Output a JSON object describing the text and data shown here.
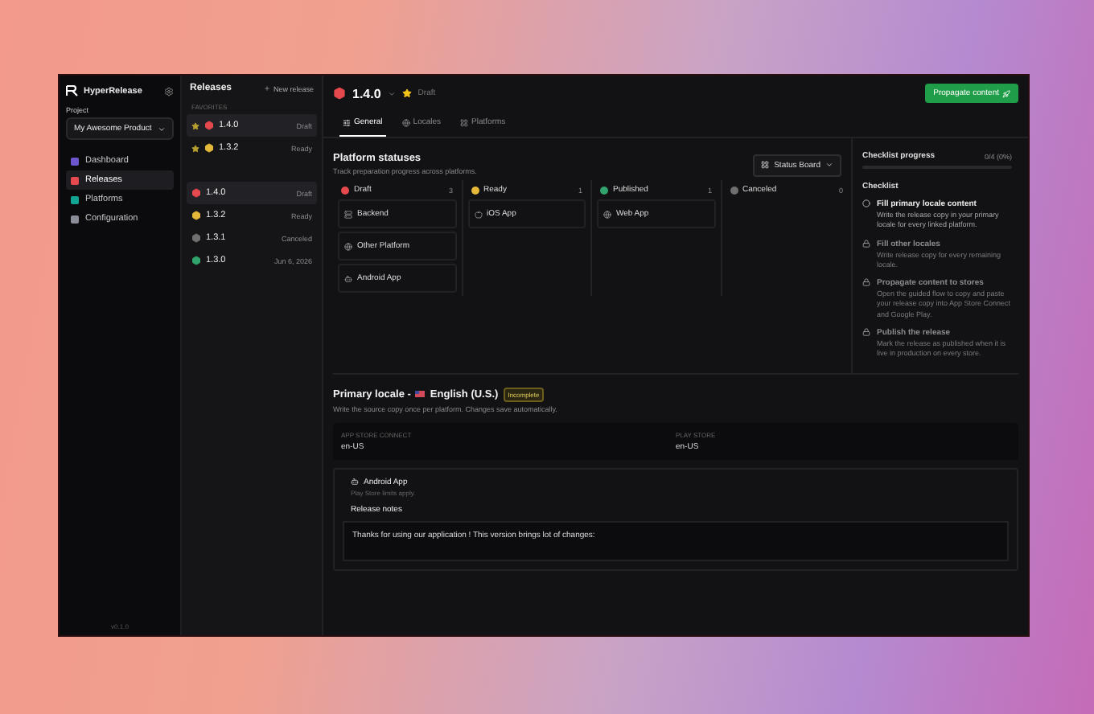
{
  "sidebar": {
    "brand": "HyperRelease",
    "project_label": "Project",
    "project_value": "My Awesome Product",
    "nav": [
      {
        "label": "Dashboard",
        "selected": false,
        "color": "#6e56cf"
      },
      {
        "label": "Releases",
        "selected": true,
        "color": "#e5484d"
      },
      {
        "label": "Platforms",
        "selected": false,
        "color": "#12a594"
      },
      {
        "label": "Configuration",
        "selected": false,
        "color": "#8b8d98"
      }
    ],
    "version": "v0.1.0"
  },
  "releases": {
    "title": "Releases",
    "new_button": "New release",
    "favorites_label": "FAVORITES",
    "favorites": [
      {
        "version": "1.4.0",
        "status": "Draft",
        "color": "#e5484d",
        "selected": true
      },
      {
        "version": "1.3.2",
        "status": "Ready",
        "color": "#e5b83a",
        "selected": false
      }
    ],
    "items": [
      {
        "version": "1.4.0",
        "status": "Draft",
        "color": "#e5484d",
        "selected": true
      },
      {
        "version": "1.3.2",
        "status": "Ready",
        "color": "#e5b83a",
        "selected": false
      },
      {
        "version": "1.3.1",
        "status": "Canceled",
        "color": "#6f6f6f",
        "selected": false
      },
      {
        "version": "1.3.0",
        "status": "Jun 6, 2026",
        "color": "#30a46c",
        "selected": false
      }
    ]
  },
  "header": {
    "version": "1.4.0",
    "color": "#e5484d",
    "starred": true,
    "status": "Draft",
    "propagate_button": "Propagate content"
  },
  "tabs": [
    {
      "label": "General",
      "selected": true
    },
    {
      "label": "Locales",
      "selected": false
    },
    {
      "label": "Platforms",
      "selected": false
    }
  ],
  "platform_statuses": {
    "title": "Platform statuses",
    "subtitle": "Track preparation progress across platforms.",
    "view_select": "Status Board",
    "columns": [
      {
        "label": "Draft",
        "count": "3",
        "color": "#e5484d",
        "items": [
          {
            "name": "Backend",
            "kind": "server"
          },
          {
            "name": "Other Platform",
            "kind": "globe"
          },
          {
            "name": "Android App",
            "kind": "android"
          }
        ]
      },
      {
        "label": "Ready",
        "count": "1",
        "color": "#e5b83a",
        "items": [
          {
            "name": "iOS App",
            "kind": "apple"
          }
        ]
      },
      {
        "label": "Published",
        "count": "1",
        "color": "#30a46c",
        "items": [
          {
            "name": "Web App",
            "kind": "globe"
          }
        ]
      },
      {
        "label": "Canceled",
        "count": "0",
        "color": "#6f6f6f"
      }
    ]
  },
  "checklist": {
    "progress_title": "Checklist progress",
    "progress_value": "0/4 (0%)",
    "level": 0,
    "title": "Checklist",
    "items": [
      {
        "title": "Fill primary locale content",
        "text": "Write the release copy in your primary locale for every linked platform.",
        "locked": false
      },
      {
        "title": "Fill other locales",
        "text": "Write release copy for every remaining locale.",
        "locked": true
      },
      {
        "title": "Propagate content to stores",
        "text": "Open the guided flow to copy and paste your release copy into App Store Connect and Google Play.",
        "locked": true
      },
      {
        "title": "Publish the release",
        "text": "Mark the release as published when it is live in production on every store.",
        "locked": true
      }
    ]
  },
  "primary_locale": {
    "title": "Primary locale -",
    "locale": "English (U.S.)",
    "badge": "Incomplete",
    "subtitle": "Write the source copy once per platform. Changes save automatically.",
    "fields": [
      {
        "label": "APP STORE CONNECT",
        "value": "en-US"
      },
      {
        "label": "PLAY STORE",
        "value": "en-US"
      }
    ]
  },
  "platform_card": {
    "name": "Android App",
    "hint": "Play Store limits apply.",
    "section": "Release notes",
    "notes": "Thanks for using our application ! This version brings lot of changes:"
  }
}
